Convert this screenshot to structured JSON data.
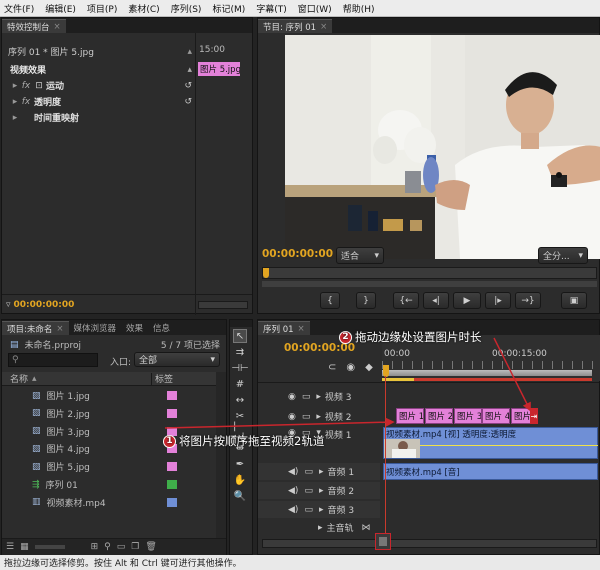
{
  "menu": [
    "文件(F)",
    "编辑(E)",
    "项目(P)",
    "素材(C)",
    "序列(S)",
    "标记(M)",
    "字幕(T)",
    "窗口(W)",
    "帮助(H)"
  ],
  "effect_controls": {
    "tab": "特效控制台",
    "sequence_clip": "序列 01 * 图片 5.jpg",
    "time": "15:00",
    "section": "视频效果",
    "effects": [
      "运动",
      "透明度",
      "时间重映射"
    ],
    "clip_label": "图片 5.jpg",
    "timecode": "00:00:00:00"
  },
  "program": {
    "tab": "节目: 序列 01",
    "timecode": "00:00:00:00",
    "fit": "适合",
    "quality": "全分..."
  },
  "project": {
    "tabs": [
      "项目:未命名",
      "媒体浏览器",
      "效果",
      "信息"
    ],
    "project_file": "未命名.prproj",
    "selection": "5 / 7 项已选择",
    "entry_label": "入口:",
    "entry_value": "全部",
    "columns": [
      "名称",
      "标签"
    ],
    "items": [
      {
        "name": "图片 1.jpg",
        "color": "#e381d9"
      },
      {
        "name": "图片 2.jpg",
        "color": "#e381d9"
      },
      {
        "name": "图片 3.jpg",
        "color": "#e381d9"
      },
      {
        "name": "图片 4.jpg",
        "color": "#e381d9"
      },
      {
        "name": "图片 5.jpg",
        "color": "#e381d9"
      },
      {
        "name": "序列 01",
        "color": "#3fae4a"
      },
      {
        "name": "视频素材.mp4",
        "color": "#6f8fd6"
      }
    ]
  },
  "timeline": {
    "tab": "序列 01",
    "timecode": "00:00:00:00",
    "ruler": [
      "00:00",
      "00:00:15:00"
    ],
    "tracks": [
      "视频 3",
      "视频 2",
      "视频 1",
      "音频 1",
      "音频 2",
      "音频 3",
      "主音轨"
    ],
    "image_clips": [
      "图片 1",
      "图片 2",
      "图片 3",
      "图片 4",
      "图片 5"
    ],
    "video_clip": "视频素材.mp4 [视] 透明度:透明度",
    "audio_clip": "视频素材.mp4 [音]"
  },
  "annotations": {
    "one_num": "1",
    "one_text": "将图片按顺序拖至视频2轨道",
    "two_num": "2",
    "two_text": "拖动边缘处设置图片时长"
  },
  "status": "拖拉边缘可选择修剪。按住 Alt 和 Ctrl 键可进行其他操作。",
  "colors": {
    "accent": "#e2a521",
    "image_clip": "#e381d9",
    "video_clip": "#6f8fd6",
    "annotation": "#c9262d"
  }
}
